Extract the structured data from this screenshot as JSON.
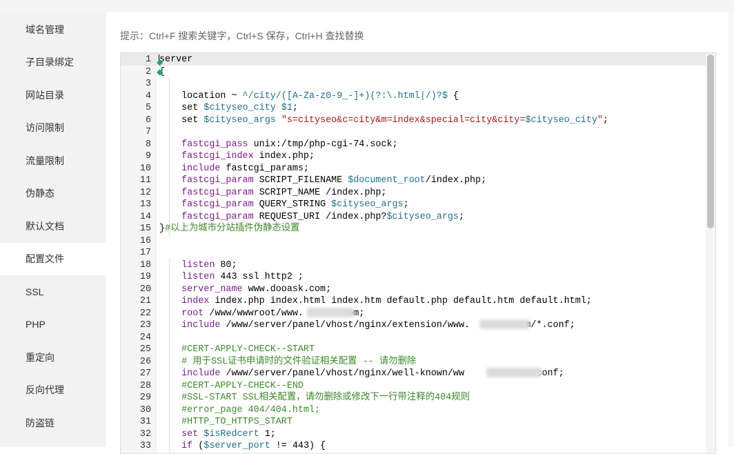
{
  "sidebar": {
    "items": [
      {
        "label": "域名管理"
      },
      {
        "label": "子目录绑定"
      },
      {
        "label": "网站目录"
      },
      {
        "label": "访问限制"
      },
      {
        "label": "流量限制"
      },
      {
        "label": "伪静态"
      },
      {
        "label": "默认文档"
      },
      {
        "label": "配置文件",
        "active": true
      },
      {
        "label": "SSL"
      },
      {
        "label": "PHP"
      },
      {
        "label": "重定向"
      },
      {
        "label": "反向代理"
      },
      {
        "label": "防盗链"
      }
    ]
  },
  "hint": "提示：Ctrl+F 搜索关键字，Ctrl+S 保存，Ctrl+H 查找替换",
  "editor": {
    "lines": [
      {
        "n": "1",
        "t": [
          {
            "c": "t",
            "s": "server"
          }
        ]
      },
      {
        "n": "2",
        "t": [
          {
            "c": "t",
            "s": "{"
          }
        ]
      },
      {
        "n": "3",
        "t": []
      },
      {
        "n": "4",
        "t": [
          {
            "c": "t",
            "s": "    location ~ "
          },
          {
            "c": "v",
            "s": "^/city/([A-Za-z0-9_-]+)(?:\\.html|/)?$"
          },
          {
            "c": "t",
            "s": " {"
          }
        ]
      },
      {
        "n": "5",
        "t": [
          {
            "c": "t",
            "s": "    set "
          },
          {
            "c": "v",
            "s": "$cityseo_city"
          },
          {
            "c": "t",
            "s": " "
          },
          {
            "c": "v",
            "s": "$1"
          },
          {
            "c": "t",
            "s": ";"
          }
        ]
      },
      {
        "n": "6",
        "t": [
          {
            "c": "t",
            "s": "    set "
          },
          {
            "c": "v",
            "s": "$cityseo_args"
          },
          {
            "c": "t",
            "s": " "
          },
          {
            "c": "s",
            "s": "\"s=cityseo&c=city&m=index&special=city&city="
          },
          {
            "c": "v",
            "s": "$cityseo_city"
          },
          {
            "c": "s",
            "s": "\""
          },
          {
            "c": "t",
            "s": ";"
          }
        ]
      },
      {
        "n": "7",
        "t": []
      },
      {
        "n": "8",
        "t": [
          {
            "c": "k",
            "s": "    fastcgi_pass"
          },
          {
            "c": "t",
            "s": " unix:/tmp/php-cgi-74.sock;"
          }
        ]
      },
      {
        "n": "9",
        "t": [
          {
            "c": "k",
            "s": "    fastcgi_index"
          },
          {
            "c": "t",
            "s": " index.php;"
          }
        ]
      },
      {
        "n": "10",
        "t": [
          {
            "c": "k",
            "s": "    include"
          },
          {
            "c": "t",
            "s": " fastcgi_params;"
          }
        ]
      },
      {
        "n": "11",
        "t": [
          {
            "c": "k",
            "s": "    fastcgi_param"
          },
          {
            "c": "t",
            "s": " SCRIPT_FILENAME "
          },
          {
            "c": "v",
            "s": "$document_root"
          },
          {
            "c": "t",
            "s": "/index.php;"
          }
        ]
      },
      {
        "n": "12",
        "t": [
          {
            "c": "k",
            "s": "    fastcgi_param"
          },
          {
            "c": "t",
            "s": " SCRIPT_NAME /index.php;"
          }
        ]
      },
      {
        "n": "13",
        "t": [
          {
            "c": "k",
            "s": "    fastcgi_param"
          },
          {
            "c": "t",
            "s": " QUERY_STRING "
          },
          {
            "c": "v",
            "s": "$cityseo_args"
          },
          {
            "c": "t",
            "s": ";"
          }
        ]
      },
      {
        "n": "14",
        "t": [
          {
            "c": "k",
            "s": "    fastcgi_param"
          },
          {
            "c": "t",
            "s": " REQUEST_URI /index.php?"
          },
          {
            "c": "v",
            "s": "$cityseo_args"
          },
          {
            "c": "t",
            "s": ";"
          }
        ]
      },
      {
        "n": "15",
        "t": [
          {
            "c": "t",
            "s": "}"
          },
          {
            "c": "c",
            "s": "#以上为城市分站插件伪静态设置"
          }
        ]
      },
      {
        "n": "16",
        "t": []
      },
      {
        "n": "17",
        "t": []
      },
      {
        "n": "18",
        "t": [
          {
            "c": "k",
            "s": "    listen"
          },
          {
            "c": "t",
            "s": " 80;"
          }
        ]
      },
      {
        "n": "19",
        "t": [
          {
            "c": "k",
            "s": "    listen"
          },
          {
            "c": "t",
            "s": " 443 ssl http2 ;"
          }
        ]
      },
      {
        "n": "20",
        "t": [
          {
            "c": "k",
            "s": "    server_name"
          },
          {
            "c": "t",
            "s": " www.dooask.com;"
          }
        ]
      },
      {
        "n": "21",
        "t": [
          {
            "c": "k",
            "s": "    index"
          },
          {
            "c": "t",
            "s": " index.php index.html index.htm default.php default.htm default.html;"
          }
        ]
      },
      {
        "n": "22",
        "t": [
          {
            "c": "k",
            "s": "    root"
          },
          {
            "c": "t",
            "s": " /www/wwwroot/www.        om;"
          }
        ]
      },
      {
        "n": "23",
        "t": [
          {
            "c": "k",
            "s": "    include"
          },
          {
            "c": "t",
            "s": " /www/server/panel/vhost/nginx/extension/www.         om/*.conf;"
          }
        ]
      },
      {
        "n": "24",
        "t": []
      },
      {
        "n": "25",
        "t": [
          {
            "c": "c",
            "s": "    #CERT-APPLY-CHECK--START"
          }
        ]
      },
      {
        "n": "26",
        "t": [
          {
            "c": "c",
            "s": "    # 用于SSL证书申请时的文件验证相关配置 -- 请勿删除"
          }
        ]
      },
      {
        "n": "27",
        "t": [
          {
            "c": "k",
            "s": "    include"
          },
          {
            "c": "t",
            "s": " /www/server/panel/vhost/nginx/well-known/ww          om.conf;"
          }
        ]
      },
      {
        "n": "28",
        "t": [
          {
            "c": "c",
            "s": "    #CERT-APPLY-CHECK--END"
          }
        ]
      },
      {
        "n": "29",
        "t": [
          {
            "c": "c",
            "s": "    #SSL-START SSL相关配置，请勿删除或修改下一行带注释的404规则"
          }
        ]
      },
      {
        "n": "30",
        "t": [
          {
            "c": "c",
            "s": "    #error_page 404/404.html;"
          }
        ]
      },
      {
        "n": "31",
        "t": [
          {
            "c": "c",
            "s": "    #HTTP_TO_HTTPS_START"
          }
        ]
      },
      {
        "n": "32",
        "t": [
          {
            "c": "k",
            "s": "    set"
          },
          {
            "c": "t",
            "s": " "
          },
          {
            "c": "v",
            "s": "$isRedcert"
          },
          {
            "c": "t",
            "s": " 1;"
          }
        ]
      },
      {
        "n": "33",
        "t": [
          {
            "c": "k",
            "s": "    if"
          },
          {
            "c": "t",
            "s": " ("
          },
          {
            "c": "v",
            "s": "$server_port"
          },
          {
            "c": "t",
            "s": " != 443) {"
          }
        ]
      }
    ]
  },
  "colors": {
    "keyword": "#7a1d8a",
    "variable": "#1f6f8b",
    "string": "#a61a1a",
    "comment": "#3c8a2a"
  }
}
